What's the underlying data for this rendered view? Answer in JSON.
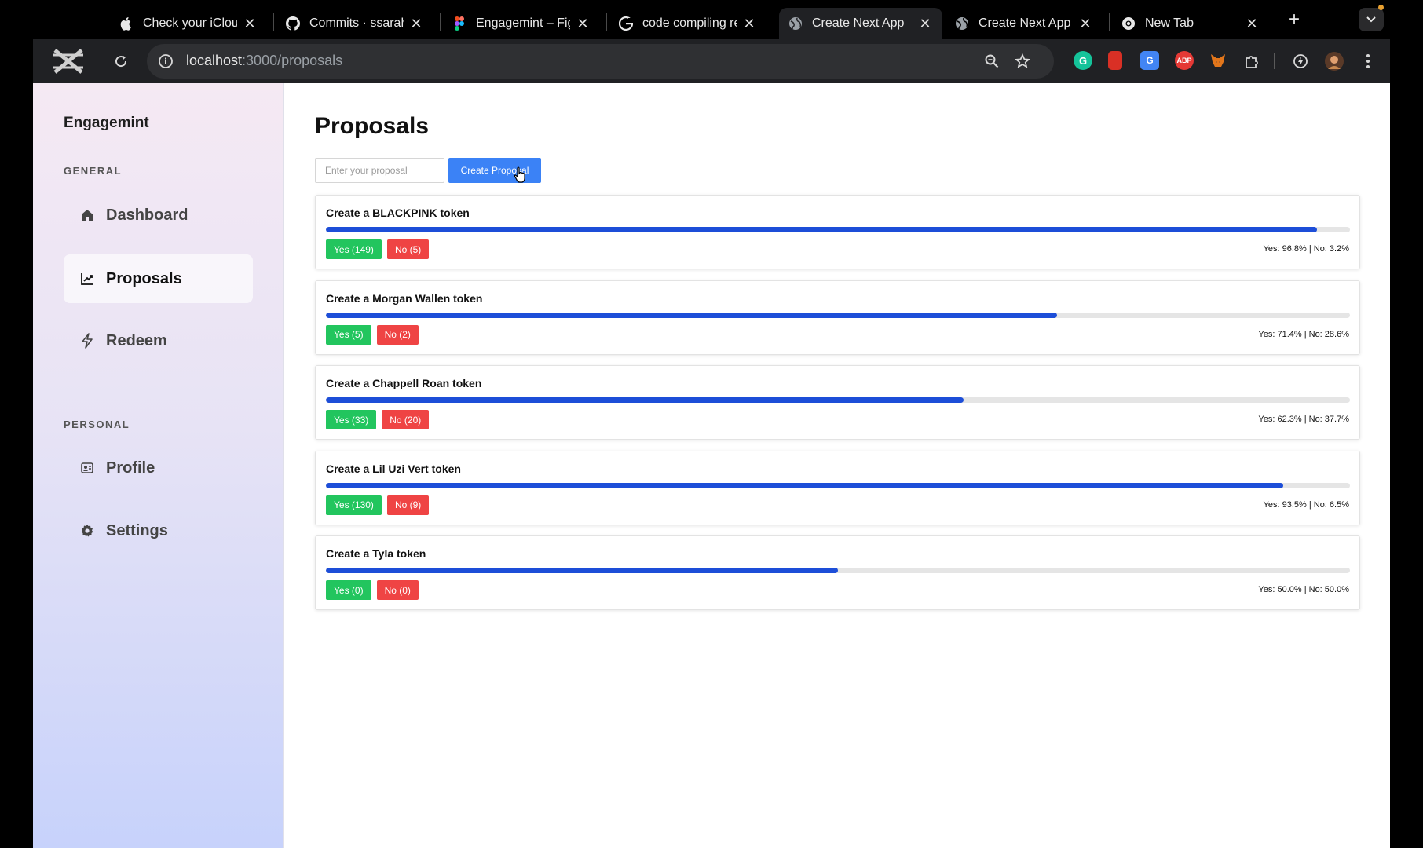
{
  "browser": {
    "tabs": [
      {
        "title": "Check your iCloud",
        "icon": "apple-icon",
        "active": false
      },
      {
        "title": "Commits · ssarahm",
        "icon": "github-icon",
        "active": false
      },
      {
        "title": "Engagemint – Figm",
        "icon": "figma-icon",
        "active": false
      },
      {
        "title": "code compiling rea",
        "icon": "google-icon",
        "active": false
      },
      {
        "title": "Create Next App",
        "icon": "globe-icon",
        "active": true
      },
      {
        "title": "Create Next App",
        "icon": "globe-icon",
        "active": false
      },
      {
        "title": "New Tab",
        "icon": "chrome-icon",
        "active": false
      }
    ],
    "url_host": "localhost",
    "url_path": ":3000/proposals",
    "extensions": [
      {
        "name": "grammarly-icon",
        "label": "G",
        "color": "#15c39a"
      },
      {
        "name": "bookmark-ext-icon",
        "label": "",
        "color": "#d93025"
      },
      {
        "name": "translate-icon",
        "label": "G",
        "color": "#4285f4"
      },
      {
        "name": "adblock-icon",
        "label": "ABP",
        "color": "#e53935"
      },
      {
        "name": "metamask-icon",
        "label": "",
        "color": "#e2761b"
      }
    ]
  },
  "sidebar": {
    "brand": "Engagemint",
    "general_label": "GENERAL",
    "personal_label": "PERSONAL",
    "items": [
      {
        "label": "Dashboard",
        "icon": "home-icon"
      },
      {
        "label": "Proposals",
        "icon": "trending-icon"
      },
      {
        "label": "Redeem",
        "icon": "lightning-icon"
      },
      {
        "label": "Profile",
        "icon": "profile-icon"
      },
      {
        "label": "Settings",
        "icon": "gear-icon"
      }
    ]
  },
  "main": {
    "title": "Proposals",
    "input_placeholder": "Enter your proposal",
    "create_button": "Create Proposal",
    "proposals": [
      {
        "title": "Create a BLACKPINK token",
        "yes": "Yes (149)",
        "no": "No (5)",
        "percent_text": "Yes: 96.8% | No: 3.2%",
        "yes_fraction": 0.968
      },
      {
        "title": "Create a Morgan Wallen token",
        "yes": "Yes (5)",
        "no": "No (2)",
        "percent_text": "Yes: 71.4% | No: 28.6%",
        "yes_fraction": 0.714
      },
      {
        "title": "Create a Chappell Roan token",
        "yes": "Yes (33)",
        "no": "No (20)",
        "percent_text": "Yes: 62.3% | No: 37.7%",
        "yes_fraction": 0.623
      },
      {
        "title": "Create a Lil Uzi Vert token",
        "yes": "Yes (130)",
        "no": "No (9)",
        "percent_text": "Yes: 93.5% | No: 6.5%",
        "yes_fraction": 0.935
      },
      {
        "title": "Create a Tyla token",
        "yes": "Yes (0)",
        "no": "No (0)",
        "percent_text": "Yes: 50.0% | No: 50.0%",
        "yes_fraction": 0.5
      }
    ]
  },
  "colors": {
    "primary": "#3b82f6",
    "bar": "#1d4ed8",
    "yes": "#22c55e",
    "no": "#ef4444"
  }
}
